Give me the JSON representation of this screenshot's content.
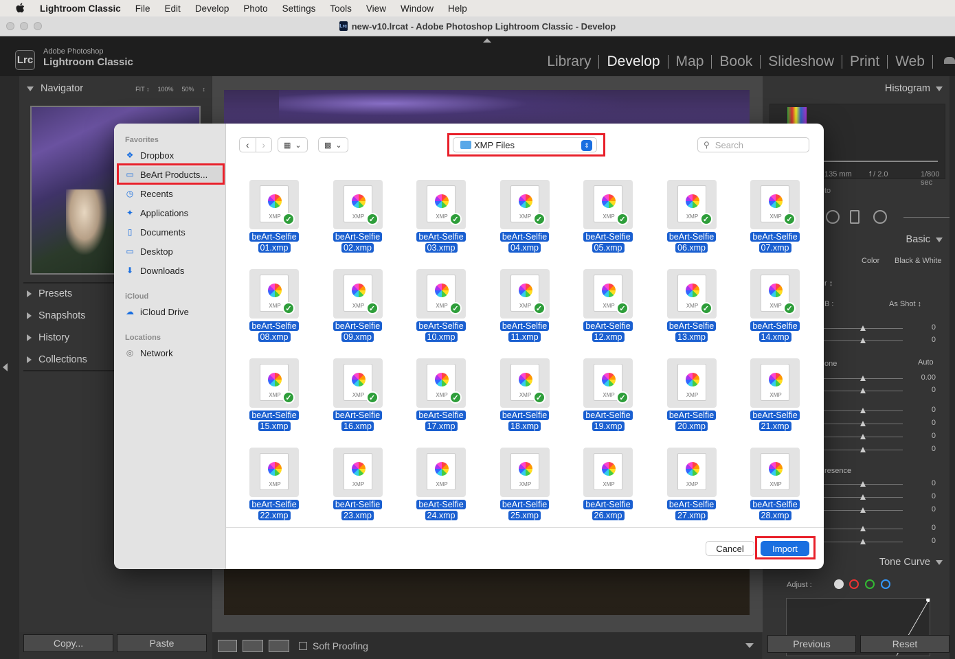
{
  "menubar": {
    "app_name": "Lightroom Classic",
    "items": [
      "File",
      "Edit",
      "Develop",
      "Photo",
      "Settings",
      "Tools",
      "View",
      "Window",
      "Help"
    ]
  },
  "window": {
    "title": "new-v10.lrcat - Adobe Photoshop Lightroom Classic - Develop",
    "doc_icon": "Lrc"
  },
  "brand": {
    "logo": "Lrc",
    "line1": "Adobe Photoshop",
    "line2": "Lightroom Classic"
  },
  "modules": [
    "Library",
    "Develop",
    "Map",
    "Book",
    "Slideshow",
    "Print",
    "Web"
  ],
  "active_module": "Develop",
  "left_panel": {
    "navigator": "Navigator",
    "zoom": [
      "FIT ↕",
      "100%",
      "50%",
      "↕"
    ],
    "sections": [
      "Presets",
      "Snapshots",
      "History",
      "Collections"
    ],
    "copy": "Copy...",
    "paste": "Paste"
  },
  "toolbar": {
    "soft_proofing": "Soft Proofing"
  },
  "right_panel": {
    "histogram": "Histogram",
    "focal": "135 mm",
    "aperture": "f / 2.0",
    "shutter": "1/800 sec",
    "auto_frag": "to",
    "basic": "Basic",
    "color": "Color",
    "bw": "Black & White",
    "wb_frag": "r ↕",
    "wb_label": "B :",
    "wb_value": "As Shot ↕",
    "tone_frag": "one",
    "auto": "Auto",
    "presence_frag": "resence",
    "values": [
      "0",
      "0",
      "0.00",
      "0",
      "0",
      "0",
      "0",
      "0",
      "0",
      "0",
      "0",
      "0",
      "0"
    ],
    "tone_curve": "Tone Curve",
    "adjust": "Adjust :",
    "previous": "Previous",
    "reset": "Reset"
  },
  "dialog": {
    "sidebar": {
      "favorites_header": "Favorites",
      "favorites": [
        {
          "icon": "dropbox-icon",
          "glyph": "❖",
          "label": "Dropbox"
        },
        {
          "icon": "folder-icon",
          "glyph": "▭",
          "label": "BeArt Products..."
        },
        {
          "icon": "clock-icon",
          "glyph": "◷",
          "label": "Recents"
        },
        {
          "icon": "applications-icon",
          "glyph": "✦",
          "label": "Applications"
        },
        {
          "icon": "document-icon",
          "glyph": "▯",
          "label": "Documents"
        },
        {
          "icon": "desktop-icon",
          "glyph": "▭",
          "label": "Desktop"
        },
        {
          "icon": "download-icon",
          "glyph": "⬇",
          "label": "Downloads"
        }
      ],
      "icloud_header": "iCloud",
      "icloud_drive": "iCloud Drive",
      "locations_header": "Locations",
      "network": "Network"
    },
    "current_folder": "XMP Files",
    "search_placeholder": "Search",
    "files": [
      {
        "line1": "beArt-Selfie",
        "line2": "01.xmp",
        "checked": true
      },
      {
        "line1": "beArt-Selfie",
        "line2": "02.xmp",
        "checked": true
      },
      {
        "line1": "beArt-Selfie",
        "line2": "03.xmp",
        "checked": true
      },
      {
        "line1": "beArt-Selfie",
        "line2": "04.xmp",
        "checked": true
      },
      {
        "line1": "beArt-Selfie",
        "line2": "05.xmp",
        "checked": true
      },
      {
        "line1": "beArt-Selfie",
        "line2": "06.xmp",
        "checked": true
      },
      {
        "line1": "beArt-Selfie",
        "line2": "07.xmp",
        "checked": true
      },
      {
        "line1": "beArt-Selfie",
        "line2": "08.xmp",
        "checked": true
      },
      {
        "line1": "beArt-Selfie",
        "line2": "09.xmp",
        "checked": true
      },
      {
        "line1": "beArt-Selfie",
        "line2": "10.xmp",
        "checked": true
      },
      {
        "line1": "beArt-Selfie",
        "line2": "11.xmp",
        "checked": true
      },
      {
        "line1": "beArt-Selfie",
        "line2": "12.xmp",
        "checked": true
      },
      {
        "line1": "beArt-Selfie",
        "line2": "13.xmp",
        "checked": true
      },
      {
        "line1": "beArt-Selfie",
        "line2": "14.xmp",
        "checked": true
      },
      {
        "line1": "beArt-Selfie",
        "line2": "15.xmp",
        "checked": true
      },
      {
        "line1": "beArt-Selfie",
        "line2": "16.xmp",
        "checked": true
      },
      {
        "line1": "beArt-Selfie",
        "line2": "17.xmp",
        "checked": true
      },
      {
        "line1": "beArt-Selfie",
        "line2": "18.xmp",
        "checked": true
      },
      {
        "line1": "beArt-Selfie",
        "line2": "19.xmp",
        "checked": true
      },
      {
        "line1": "beArt-Selfie",
        "line2": "20.xmp",
        "checked": false
      },
      {
        "line1": "beArt-Selfie",
        "line2": "21.xmp",
        "checked": false
      },
      {
        "line1": "beArt-Selfie",
        "line2": "22.xmp",
        "checked": false
      },
      {
        "line1": "beArt-Selfie",
        "line2": "23.xmp",
        "checked": false
      },
      {
        "line1": "beArt-Selfie",
        "line2": "24.xmp",
        "checked": false
      },
      {
        "line1": "beArt-Selfie",
        "line2": "25.xmp",
        "checked": false
      },
      {
        "line1": "beArt-Selfie",
        "line2": "26.xmp",
        "checked": false
      },
      {
        "line1": "beArt-Selfie",
        "line2": "27.xmp",
        "checked": false
      },
      {
        "line1": "beArt-Selfie",
        "line2": "28.xmp",
        "checked": false
      }
    ],
    "file_badge": "XMP",
    "cancel": "Cancel",
    "import": "Import"
  },
  "colors": {
    "highlight_red": "#e8202a",
    "selection_blue": "#1a5fd0",
    "accent_blue": "#1a6fe0",
    "check_green": "#2e9e3a"
  }
}
